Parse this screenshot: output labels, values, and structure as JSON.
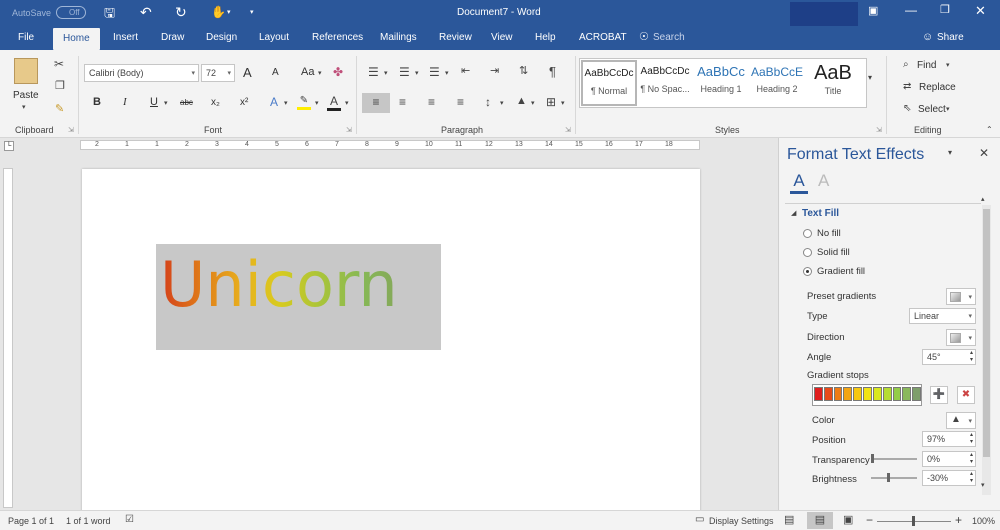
{
  "titlebar": {
    "autosave_label": "AutoSave",
    "autosave_state": "Off",
    "title": "Document7  -  Word",
    "icons": [
      "save-icon",
      "undo-icon",
      "redo-icon",
      "touch-mode-icon",
      "customize-icon",
      "ribbon-display-icon",
      "minimize-icon",
      "restore-icon",
      "close-icon"
    ]
  },
  "tabs": [
    "File",
    "Home",
    "Insert",
    "Draw",
    "Design",
    "Layout",
    "References",
    "Mailings",
    "Review",
    "View",
    "Help",
    "ACROBAT"
  ],
  "active_tab": "Home",
  "search_label": "Search",
  "share_label": "Share",
  "clipboard": {
    "paste": "Paste",
    "group": "Clipboard"
  },
  "font": {
    "name": "Calibri (Body)",
    "size": "72",
    "group": "Font",
    "case_label": "Aa",
    "strike_label": "abc",
    "sub_label": "x₂",
    "sup_label": "x²",
    "grow_label": "A",
    "shrink_label": "A"
  },
  "paragraph": {
    "group": "Paragraph"
  },
  "styles": {
    "group": "Styles",
    "items": [
      {
        "preview": "AaBbCcDc",
        "name": "¶ Normal"
      },
      {
        "preview": "AaBbCcDc",
        "name": "¶ No Spac..."
      },
      {
        "preview": "AaBbCc",
        "name": "Heading 1"
      },
      {
        "preview": "AaBbCcE",
        "name": "Heading 2"
      },
      {
        "preview": "AaB",
        "name": "Title"
      }
    ]
  },
  "editing": {
    "find": "Find",
    "replace": "Replace",
    "select": "Select",
    "group": "Editing"
  },
  "ruler_numbers": [
    "2",
    "1",
    "1",
    "2",
    "3",
    "4",
    "5",
    "6",
    "7",
    "8",
    "9",
    "10",
    "11",
    "12",
    "13",
    "14",
    "15",
    "16",
    "17",
    "18"
  ],
  "document": {
    "text": "Unicorn"
  },
  "pane": {
    "title": "Format Text Effects",
    "section": "Text Fill",
    "no_fill": "No fill",
    "solid_fill": "Solid fill",
    "gradient_fill": "Gradient fill",
    "selected_fill": "Gradient fill",
    "preset_gradients": "Preset gradients",
    "type_label": "Type",
    "type_value": "Linear",
    "direction_label": "Direction",
    "angle_label": "Angle",
    "angle_value": "45°",
    "stops_label": "Gradient stops",
    "stop_colors": [
      "#e01e1e",
      "#e84a1a",
      "#ef7c15",
      "#f3a512",
      "#f6c80f",
      "#f2e313",
      "#d9e71e",
      "#b6dc31",
      "#94cc47",
      "#8ab85c",
      "#7e9e6b"
    ],
    "color_label": "Color",
    "position_label": "Position",
    "position_value": "97%",
    "transparency_label": "Transparency",
    "transparency_value": "0%",
    "transparency_fraction": 0.0,
    "brightness_label": "Brightness",
    "brightness_value": "-30%",
    "brightness_fraction": 0.35
  },
  "status": {
    "page": "Page 1 of 1",
    "words": "1 of 1 word",
    "display_settings": "Display Settings",
    "zoom": "100%"
  }
}
